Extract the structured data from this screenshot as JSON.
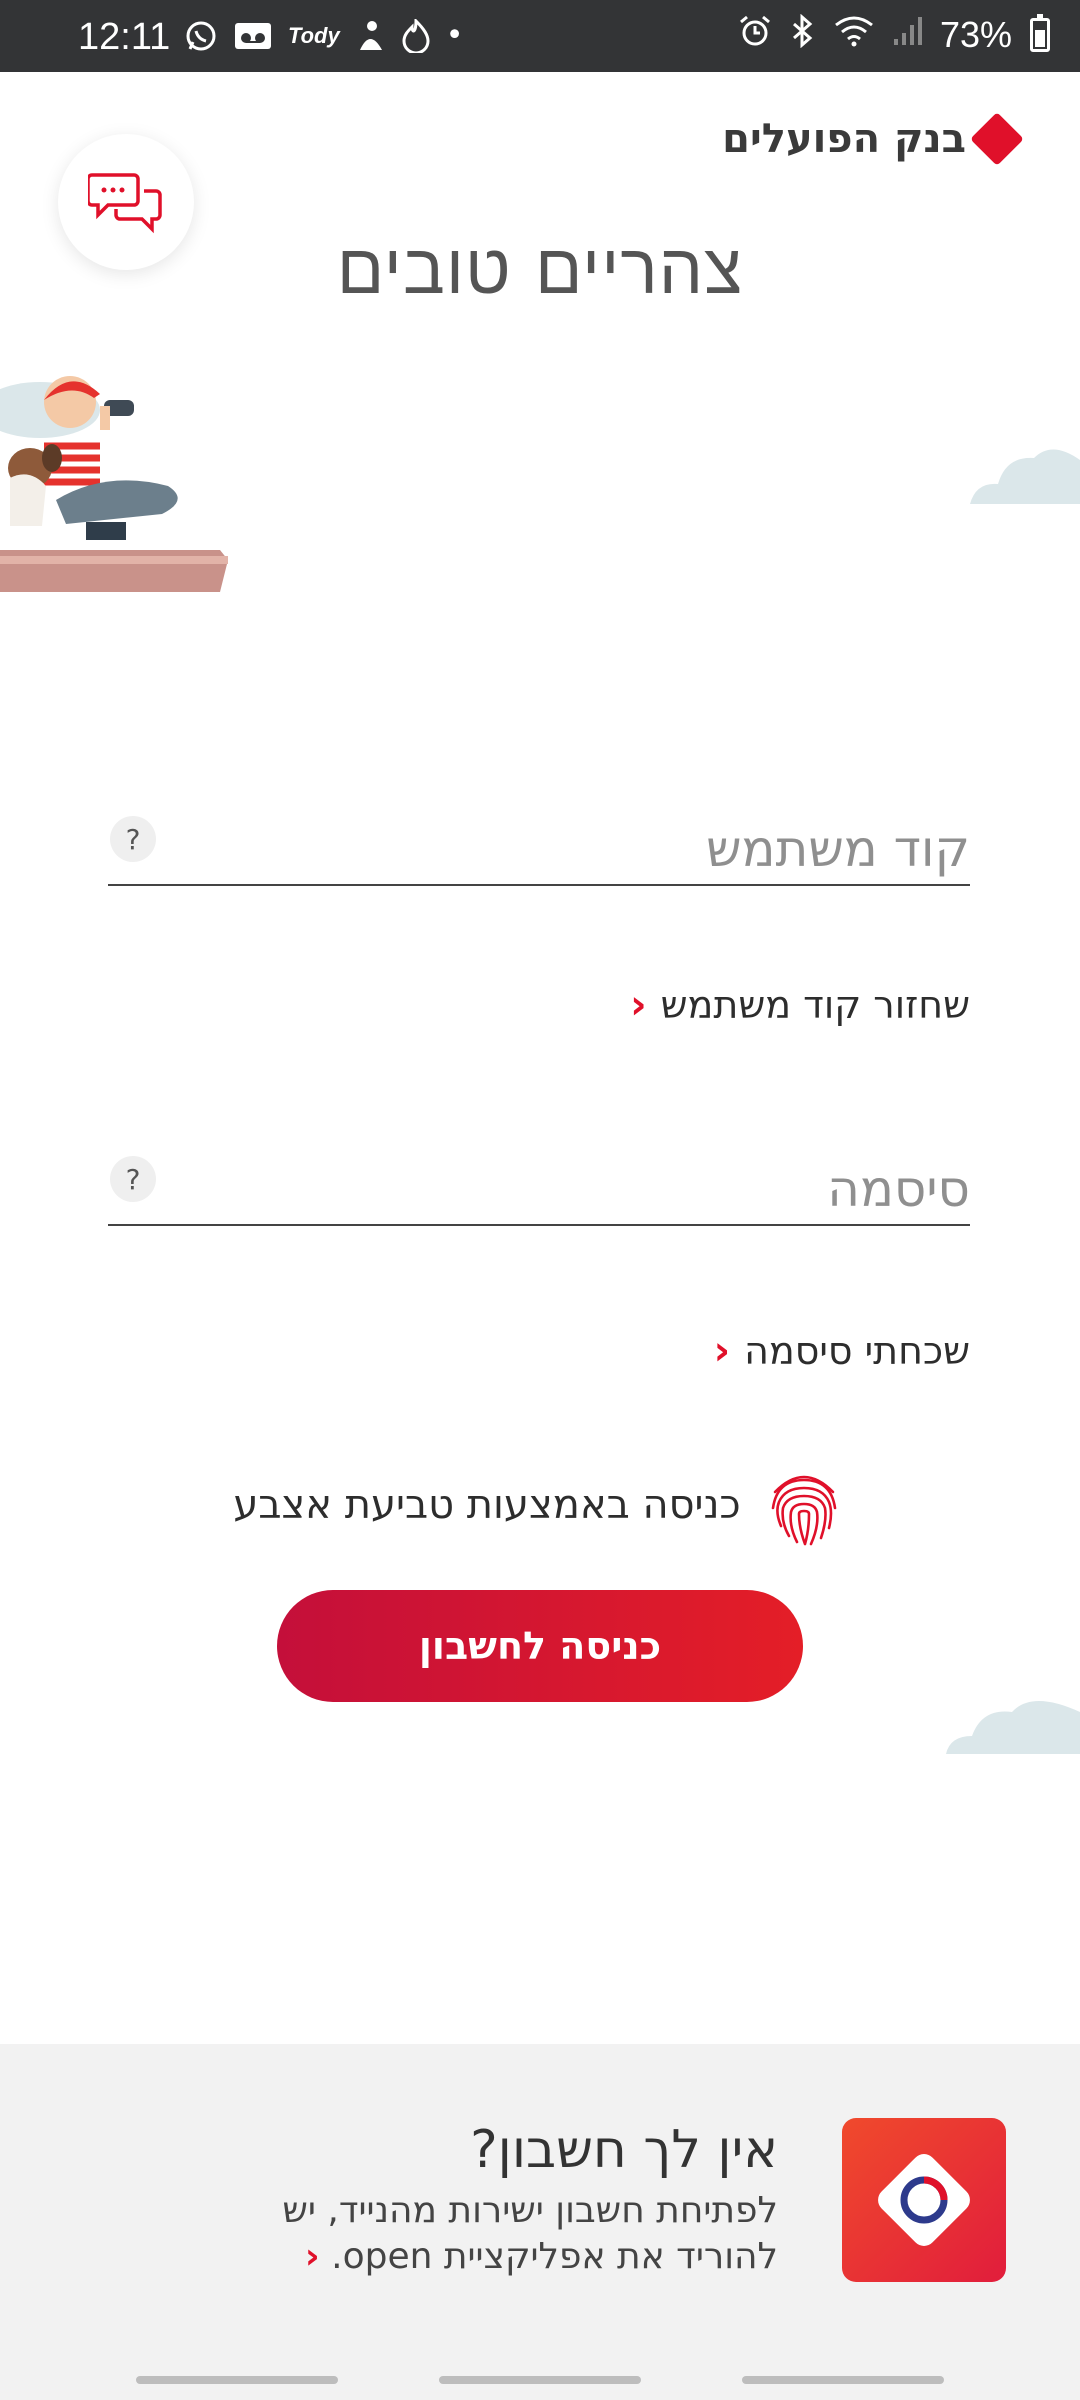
{
  "status_bar": {
    "time": "12:11",
    "battery": "73%",
    "tody_label": "Tody",
    "dot": "•",
    "notification_icons": [
      "whatsapp-icon",
      "voicemail-icon",
      "tody-icon",
      "fitness-icon",
      "tinder-icon",
      "dot-icon"
    ],
    "system_icons": [
      "alarm-icon",
      "bluetooth-icon",
      "wifi-icon",
      "signal-icon",
      "battery-icon"
    ]
  },
  "header": {
    "bank_name": "בנק הפועלים",
    "brand_color": "#e0102a",
    "chat_icon": "chat-bubbles-icon"
  },
  "greeting": "צהריים טובים",
  "form": {
    "username_label": "קוד משתמש",
    "password_label": "סיסמה",
    "help_symbol": "?",
    "recover_username": "שחזור קוד משתמש",
    "forgot_password": "שכחתי סיסמה",
    "fingerprint_login": "כניסה באמצעות טביעת אצבע",
    "login_button": "כניסה לחשבון",
    "chevron": "‹"
  },
  "banner": {
    "title": "אין לך חשבון?",
    "body": "לפתיחת חשבון ישירות מהנייד, יש להוריד את אפליקציית open.",
    "app_icon": "open-app-icon"
  }
}
